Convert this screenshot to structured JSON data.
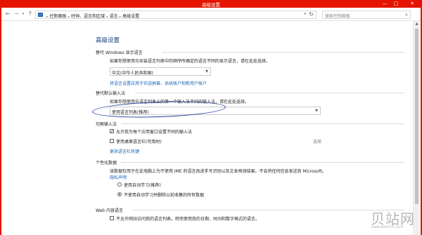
{
  "window": {
    "title": "高级设置",
    "minimize": "—",
    "maximize": "□",
    "close": "✕"
  },
  "nav": {
    "back": "←",
    "forward": "→",
    "recent": "▾",
    "up": "↑",
    "breadcrumbs": [
      "控制面板",
      "时钟、语言和区域",
      "语言",
      "高级设置"
    ],
    "separator": "▸",
    "address_dropdown": "▾",
    "refresh": "↻",
    "search_placeholder": "搜索控制面板",
    "search_icon_glyph": "⌕"
  },
  "page": {
    "title": "高级设置"
  },
  "display_language": {
    "heading": "替代 Windows 显示语言",
    "description": "如果你想使用与安装语言列表中的顺序所确定的语言不同的显示语言，请在此处选择。",
    "selected": "中文(中华人民共和国)",
    "link": "将语言设置应用于欢迎屏幕、系统帐户和新用户帐户"
  },
  "default_input": {
    "heading": "替代默认输入法",
    "description": "如果你想使用与语言列表上的第一个输入法不同的输入法，请在此处选择。",
    "selected": "使用语言列表(推荐)"
  },
  "switch_input": {
    "heading": "切换输入法",
    "options": [
      {
        "label": "允许我为每个应用窗口设置不同的输入法",
        "checked": true
      },
      {
        "label": "使用桌面语言栏(可用时)",
        "checked": false
      }
    ],
    "options_link": "选项",
    "hotkeys_link": "更改语言栏热键"
  },
  "personalization": {
    "heading": "个性化数据",
    "description": "该数据仅用于在此电脑上为不使用 IME 的语言改进手写识别以及文本预测结果。不会将任何信息发送到 Microsoft。",
    "privacy_link": "隐私声明",
    "radios": [
      {
        "label": "使用自动学习(推荐)",
        "selected": false
      },
      {
        "label": "不使用自动学习并删除以前收集的所有数据",
        "selected": true
      }
    ]
  },
  "web_content": {
    "heading": "Web 内容语言",
    "checkbox": {
      "label": "不允许网站访问我的语言列表。转而使用我的日期、时间和数字格式的语言。",
      "checked": false
    }
  },
  "scrollbar": {
    "up_arrow": "▲"
  },
  "watermark": {
    "text": "贝站网",
    "sub": "www.bzw315.com"
  },
  "colors": {
    "titlebar": "#e51400",
    "title_text": "#1b3c7a",
    "link": "#1a66b8",
    "annotation_ellipse": "#1d3b9c"
  }
}
